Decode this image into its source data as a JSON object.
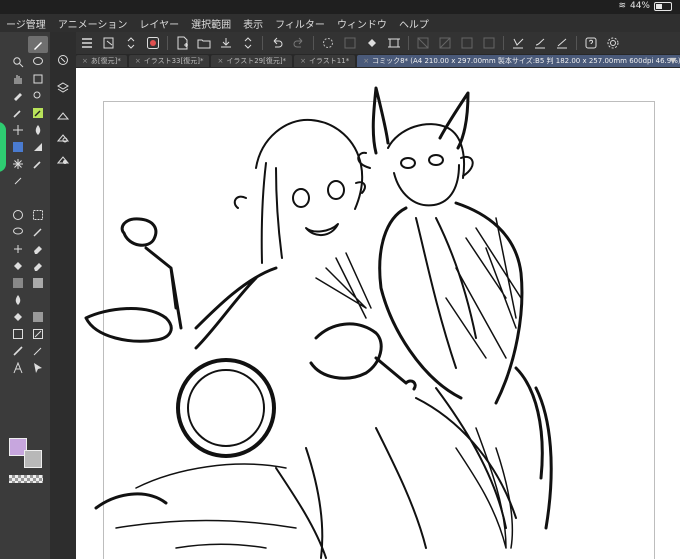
{
  "status": {
    "battery": "44%"
  },
  "menu": [
    "ージ管理",
    "アニメーション",
    "レイヤー",
    "選択範囲",
    "表示",
    "フィルター",
    "ウィンドウ",
    "ヘルプ"
  ],
  "commands": [
    "menu-icon",
    "new-page-icon",
    "stepper-icon",
    "record-icon",
    "new-file-icon",
    "open-folder-icon",
    "save-icon",
    "stepper-icon",
    "undo-icon",
    "redo-icon",
    "loading-icon",
    "deselect-icon",
    "fill-icon",
    "transform-icon",
    "grid-icon",
    "grid-icon",
    "layer-icon",
    "pen-settings-icon",
    "brush-settings-icon",
    "line-settings-icon",
    "help-icon",
    "settings-icon"
  ],
  "tabs": [
    {
      "label": "あ[復元]*",
      "active": false
    },
    {
      "label": "イラスト33[復元]*",
      "active": false
    },
    {
      "label": "イラスト29[復元]*",
      "active": false
    },
    {
      "label": "イラスト11*",
      "active": false
    },
    {
      "label": "コミック8* (A4 210.00 x 297.00mm 製本サイズ:B5 判 182.00 x 257.00mm 600dpi 46.9%)",
      "active": true
    }
  ],
  "tools": [
    "pen-icon",
    "zoom-icon",
    "speech-bubble-icon",
    "hand-icon",
    "layer-move-icon",
    "selection-brush-icon",
    "eyedropper-icon",
    "pen-tool-icon",
    "move-icon",
    "blend-icon",
    "selection-auto-icon",
    "triangle-icon",
    "sparkle-icon",
    "eyedropper-icon",
    "circle-icon",
    "rectangle-icon",
    "lasso-icon",
    "pencil-icon",
    "cross-icon",
    "eraser-icon",
    "fill-bucket-icon",
    "gradient-icon",
    "liquid-icon",
    "blank-icon",
    "fill-icon",
    "fill-gradient-icon",
    "rect-icon",
    "rect-shape-icon",
    "line-icon",
    "pencil-icon",
    "text-icon",
    "select-arrow-icon"
  ],
  "sub_tools": [
    "navigator-icon",
    "layers-icon",
    "layer-property-icon",
    "layer-search-icon",
    "layer-color-icon"
  ],
  "colors": {
    "main": "#c7a6de",
    "sub": "#b8b8b8",
    "accent": "#2ecc71",
    "tab_active": "#4a5a7a"
  }
}
